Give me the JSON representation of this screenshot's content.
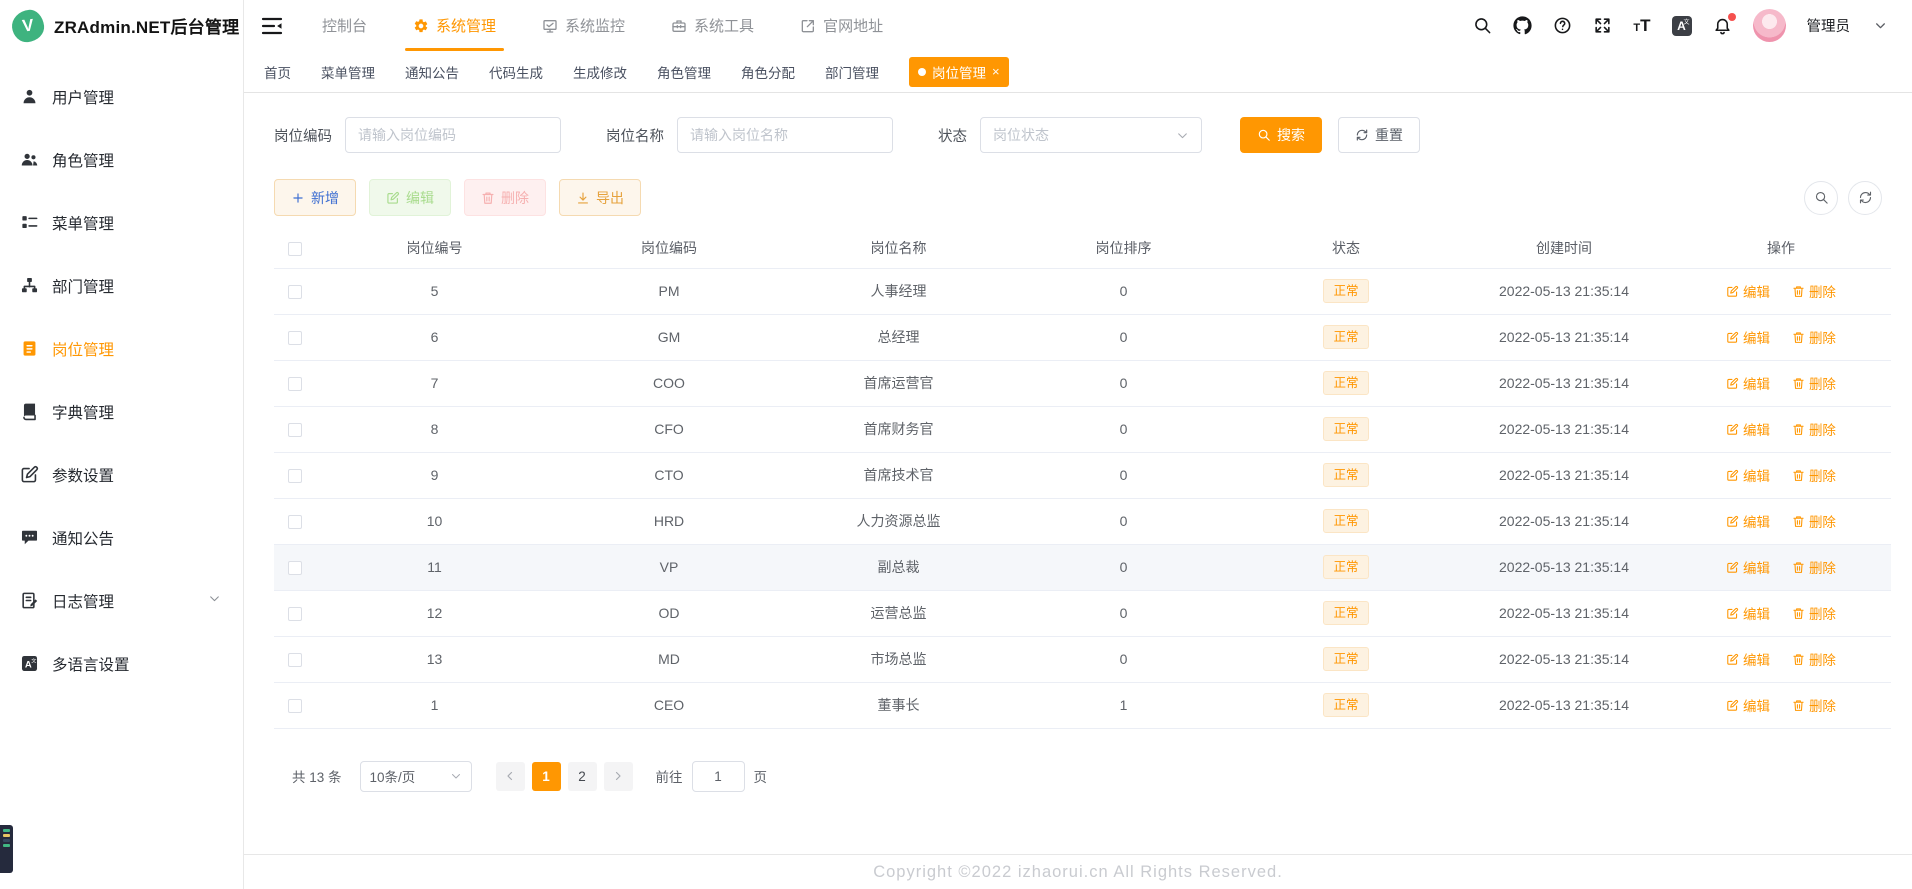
{
  "colors": {
    "accent": "#ff9702",
    "warning_tag_bg": "#fdf2e1",
    "add_text": "#3e6fd2",
    "disabled_green": "#a9dc8e",
    "disabled_red": "#f6b0b0",
    "export_text": "#e6a23c"
  },
  "app": {
    "title": "ZRAdmin.NET后台管理",
    "logo_letter": "V"
  },
  "sidebar": {
    "items": [
      {
        "label": "用户管理",
        "icon": "user-icon",
        "active": false
      },
      {
        "label": "角色管理",
        "icon": "users-icon",
        "active": false
      },
      {
        "label": "菜单管理",
        "icon": "menu-list-icon",
        "active": false
      },
      {
        "label": "部门管理",
        "icon": "org-tree-icon",
        "active": false
      },
      {
        "label": "岗位管理",
        "icon": "id-badge-icon",
        "active": true
      },
      {
        "label": "字典管理",
        "icon": "book-icon",
        "active": false
      },
      {
        "label": "参数设置",
        "icon": "edit-square-icon",
        "active": false
      },
      {
        "label": "通知公告",
        "icon": "chat-bubble-icon",
        "active": false
      },
      {
        "label": "日志管理",
        "icon": "log-document-icon",
        "active": false,
        "expandable": true
      },
      {
        "label": "多语言设置",
        "icon": "translate-icon",
        "active": false
      }
    ]
  },
  "topnav": {
    "menus": [
      {
        "label": "控制台",
        "icon": "",
        "active": false
      },
      {
        "label": "系统管理",
        "icon": "gear-icon",
        "active": true
      },
      {
        "label": "系统监控",
        "icon": "monitor-icon",
        "active": false
      },
      {
        "label": "系统工具",
        "icon": "toolbox-icon",
        "active": false
      },
      {
        "label": "官网地址",
        "icon": "external-link-icon",
        "active": false
      }
    ],
    "user": "管理员",
    "right_icons": [
      "search-icon",
      "github-icon",
      "help-icon",
      "fullscreen-icon",
      "font-size-icon",
      "translate-icon",
      "bell-icon",
      "avatar"
    ]
  },
  "tabs": {
    "items": [
      "首页",
      "菜单管理",
      "通知公告",
      "代码生成",
      "生成修改",
      "角色管理",
      "角色分配",
      "部门管理"
    ],
    "active": "岗位管理",
    "dot": "●",
    "close": "×"
  },
  "filters": {
    "code_label": "岗位编码",
    "code_placeholder": "请输入岗位编码",
    "name_label": "岗位名称",
    "name_placeholder": "请输入岗位名称",
    "status_label": "状态",
    "status_placeholder": "岗位状态",
    "search_label": "搜索",
    "reset_label": "重置"
  },
  "toolbar": {
    "add_label": "新增",
    "edit_label": "编辑",
    "delete_label": "删除",
    "export_label": "导出"
  },
  "table": {
    "headers": [
      "岗位编号",
      "岗位编码",
      "岗位名称",
      "岗位排序",
      "状态",
      "创建时间",
      "操作"
    ],
    "status_normal": "正常",
    "edit_label": "编辑",
    "delete_label": "删除",
    "rows": [
      {
        "id": "5",
        "code": "PM",
        "name": "人事经理",
        "sort": "0",
        "status": "正常",
        "time": "2022-05-13 21:35:14"
      },
      {
        "id": "6",
        "code": "GM",
        "name": "总经理",
        "sort": "0",
        "status": "正常",
        "time": "2022-05-13 21:35:14"
      },
      {
        "id": "7",
        "code": "COO",
        "name": "首席运营官",
        "sort": "0",
        "status": "正常",
        "time": "2022-05-13 21:35:14"
      },
      {
        "id": "8",
        "code": "CFO",
        "name": "首席财务官",
        "sort": "0",
        "status": "正常",
        "time": "2022-05-13 21:35:14"
      },
      {
        "id": "9",
        "code": "CTO",
        "name": "首席技术官",
        "sort": "0",
        "status": "正常",
        "time": "2022-05-13 21:35:14"
      },
      {
        "id": "10",
        "code": "HRD",
        "name": "人力资源总监",
        "sort": "0",
        "status": "正常",
        "time": "2022-05-13 21:35:14"
      },
      {
        "id": "11",
        "code": "VP",
        "name": "副总裁",
        "sort": "0",
        "status": "正常",
        "time": "2022-05-13 21:35:14",
        "highlight": true
      },
      {
        "id": "12",
        "code": "OD",
        "name": "运营总监",
        "sort": "0",
        "status": "正常",
        "time": "2022-05-13 21:35:14"
      },
      {
        "id": "13",
        "code": "MD",
        "name": "市场总监",
        "sort": "0",
        "status": "正常",
        "time": "2022-05-13 21:35:14"
      },
      {
        "id": "1",
        "code": "CEO",
        "name": "董事长",
        "sort": "1",
        "status": "正常",
        "time": "2022-05-13 21:35:14"
      }
    ]
  },
  "pagination": {
    "total": "共 13 条",
    "page_size": "10条/页",
    "pages": [
      "1",
      "2"
    ],
    "active_page": "1",
    "goto_label": "前往",
    "goto_value": "1",
    "page_unit": "页"
  },
  "footer": {
    "copyright": "Copyright ©2022 izhaorui.cn All Rights Reserved."
  }
}
